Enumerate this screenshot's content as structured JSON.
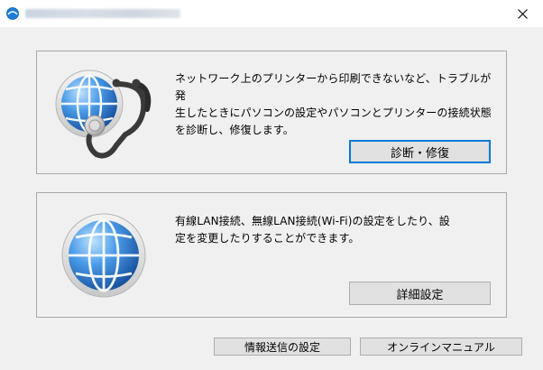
{
  "window": {
    "title": "",
    "close_glyph": "✕"
  },
  "diagnose_panel": {
    "description": "ネットワーク上のプリンターから印刷できないなど、トラブルが発\n生したときにパソコンの設定やパソコンとプリンターの接続状態\nを診断し、修復します。",
    "button_label": "診断・修復",
    "icon": "globe-stethoscope-icon"
  },
  "settings_panel": {
    "description": "有線LAN接続、無線LAN接続(Wi-Fi)の設定をしたり、設\n定を変更したりすることができます。",
    "button_label": "詳細設定",
    "icon": "globe-icon"
  },
  "footer": {
    "info_send_label": "情報送信の設定",
    "online_manual_label": "オンラインマニュアル"
  },
  "colors": {
    "accent": "#0078d7",
    "panel_border": "#a9a9a9",
    "button_bg": "#e1e1e1"
  }
}
